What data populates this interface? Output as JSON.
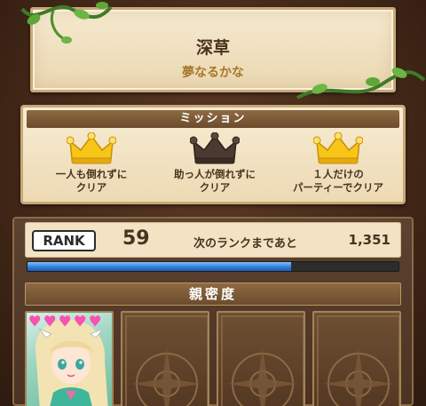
{
  "stage": {
    "name": "深草",
    "subtitle": "夢なるかな"
  },
  "mission": {
    "header": "ミッション",
    "items": [
      {
        "text_line1": "一人も倒れずに",
        "text_line2": "クリア",
        "achieved": true,
        "crown_icon": "gold-crown-icon"
      },
      {
        "text_line1": "助っ人が倒れずに",
        "text_line2": "クリア",
        "achieved": false,
        "crown_icon": "dark-crown-icon"
      },
      {
        "text_line1": "１人だけの",
        "text_line2": "パーティーでクリア",
        "achieved": true,
        "crown_icon": "gold-crown-icon"
      }
    ]
  },
  "rank": {
    "badge": "RANK",
    "value": "59",
    "next_label": "次のランクまであと",
    "next_value": "1,351",
    "exp_progress": 0.71
  },
  "intimacy": {
    "header": "親密度",
    "slots": [
      {
        "type": "character",
        "hearts": 5
      },
      {
        "type": "empty"
      },
      {
        "type": "empty"
      },
      {
        "type": "empty"
      }
    ]
  },
  "colors": {
    "gold": "#f7c619",
    "dark_crown": "#4a3a30",
    "heart": "#ff4fb0",
    "exp_bar": "#2d79d8"
  }
}
